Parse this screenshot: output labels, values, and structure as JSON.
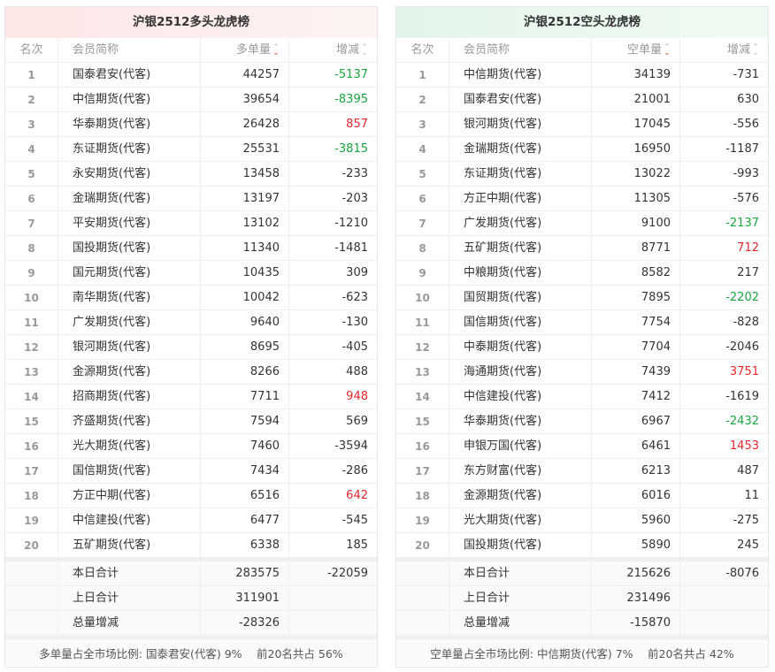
{
  "panels": [
    {
      "title": "沪银2512多头龙虎榜",
      "headers": {
        "rank": "名次",
        "member": "会员简称",
        "volume": "多单量",
        "change": "增减"
      },
      "rows": [
        {
          "rank": "1",
          "member": "国泰君安(代客)",
          "volume": "44257",
          "change": "-5137",
          "color": "green"
        },
        {
          "rank": "2",
          "member": "中信期货(代客)",
          "volume": "39654",
          "change": "-8395",
          "color": "green"
        },
        {
          "rank": "3",
          "member": "华泰期货(代客)",
          "volume": "26428",
          "change": "857",
          "color": "red"
        },
        {
          "rank": "4",
          "member": "东证期货(代客)",
          "volume": "25531",
          "change": "-3815",
          "color": "green"
        },
        {
          "rank": "5",
          "member": "永安期货(代客)",
          "volume": "13458",
          "change": "-233",
          "color": ""
        },
        {
          "rank": "6",
          "member": "金瑞期货(代客)",
          "volume": "13197",
          "change": "-203",
          "color": ""
        },
        {
          "rank": "7",
          "member": "平安期货(代客)",
          "volume": "13102",
          "change": "-1210",
          "color": ""
        },
        {
          "rank": "8",
          "member": "国投期货(代客)",
          "volume": "11340",
          "change": "-1481",
          "color": ""
        },
        {
          "rank": "9",
          "member": "国元期货(代客)",
          "volume": "10435",
          "change": "309",
          "color": ""
        },
        {
          "rank": "10",
          "member": "南华期货(代客)",
          "volume": "10042",
          "change": "-623",
          "color": ""
        },
        {
          "rank": "11",
          "member": "广发期货(代客)",
          "volume": "9640",
          "change": "-130",
          "color": ""
        },
        {
          "rank": "12",
          "member": "银河期货(代客)",
          "volume": "8695",
          "change": "-405",
          "color": ""
        },
        {
          "rank": "13",
          "member": "金源期货(代客)",
          "volume": "8266",
          "change": "488",
          "color": ""
        },
        {
          "rank": "14",
          "member": "招商期货(代客)",
          "volume": "7711",
          "change": "948",
          "color": "red"
        },
        {
          "rank": "15",
          "member": "齐盛期货(代客)",
          "volume": "7594",
          "change": "569",
          "color": ""
        },
        {
          "rank": "16",
          "member": "光大期货(代客)",
          "volume": "7460",
          "change": "-3594",
          "color": ""
        },
        {
          "rank": "17",
          "member": "国信期货(代客)",
          "volume": "7434",
          "change": "-286",
          "color": ""
        },
        {
          "rank": "18",
          "member": "方正中期(代客)",
          "volume": "6516",
          "change": "642",
          "color": "red"
        },
        {
          "rank": "19",
          "member": "中信建投(代客)",
          "volume": "6477",
          "change": "-545",
          "color": ""
        },
        {
          "rank": "20",
          "member": "五矿期货(代客)",
          "volume": "6338",
          "change": "185",
          "color": ""
        }
      ],
      "summary": [
        {
          "label": "本日合计",
          "volume": "283575",
          "change": "-22059"
        },
        {
          "label": "上日合计",
          "volume": "311901",
          "change": ""
        },
        {
          "label": "总量增减",
          "volume": "-28326",
          "change": ""
        }
      ],
      "footer": "多单量占全市场比例: 国泰君安(代客) 9%　 前20名共占 56%"
    },
    {
      "title": "沪银2512空头龙虎榜",
      "headers": {
        "rank": "名次",
        "member": "会员简称",
        "volume": "空单量",
        "change": "增减"
      },
      "rows": [
        {
          "rank": "1",
          "member": "中信期货(代客)",
          "volume": "34139",
          "change": "-731",
          "color": ""
        },
        {
          "rank": "2",
          "member": "国泰君安(代客)",
          "volume": "21001",
          "change": "630",
          "color": ""
        },
        {
          "rank": "3",
          "member": "银河期货(代客)",
          "volume": "17045",
          "change": "-556",
          "color": ""
        },
        {
          "rank": "4",
          "member": "金瑞期货(代客)",
          "volume": "16950",
          "change": "-1187",
          "color": ""
        },
        {
          "rank": "5",
          "member": "东证期货(代客)",
          "volume": "13022",
          "change": "-993",
          "color": ""
        },
        {
          "rank": "6",
          "member": "方正中期(代客)",
          "volume": "11305",
          "change": "-576",
          "color": ""
        },
        {
          "rank": "7",
          "member": "广发期货(代客)",
          "volume": "9100",
          "change": "-2137",
          "color": "green"
        },
        {
          "rank": "8",
          "member": "五矿期货(代客)",
          "volume": "8771",
          "change": "712",
          "color": "red"
        },
        {
          "rank": "9",
          "member": "中粮期货(代客)",
          "volume": "8582",
          "change": "217",
          "color": ""
        },
        {
          "rank": "10",
          "member": "国贸期货(代客)",
          "volume": "7895",
          "change": "-2202",
          "color": "green"
        },
        {
          "rank": "11",
          "member": "国信期货(代客)",
          "volume": "7754",
          "change": "-828",
          "color": ""
        },
        {
          "rank": "12",
          "member": "中泰期货(代客)",
          "volume": "7704",
          "change": "-2046",
          "color": ""
        },
        {
          "rank": "13",
          "member": "海通期货(代客)",
          "volume": "7439",
          "change": "3751",
          "color": "red"
        },
        {
          "rank": "14",
          "member": "中信建投(代客)",
          "volume": "7412",
          "change": "-1619",
          "color": ""
        },
        {
          "rank": "15",
          "member": "华泰期货(代客)",
          "volume": "6967",
          "change": "-2432",
          "color": "green"
        },
        {
          "rank": "16",
          "member": "申银万国(代客)",
          "volume": "6461",
          "change": "1453",
          "color": "red"
        },
        {
          "rank": "17",
          "member": "东方财富(代客)",
          "volume": "6213",
          "change": "487",
          "color": ""
        },
        {
          "rank": "18",
          "member": "金源期货(代客)",
          "volume": "6016",
          "change": "11",
          "color": ""
        },
        {
          "rank": "19",
          "member": "光大期货(代客)",
          "volume": "5960",
          "change": "-275",
          "color": ""
        },
        {
          "rank": "20",
          "member": "国投期货(代客)",
          "volume": "5890",
          "change": "245",
          "color": ""
        }
      ],
      "summary": [
        {
          "label": "本日合计",
          "volume": "215626",
          "change": "-8076"
        },
        {
          "label": "上日合计",
          "volume": "231496",
          "change": ""
        },
        {
          "label": "总量增减",
          "volume": "-15870",
          "change": ""
        }
      ],
      "footer": "空单量占全市场比例: 中信期货(代客) 7%　 前20名共占 42%"
    }
  ],
  "colors": {
    "up": "#e8262d",
    "down": "#19a540"
  }
}
